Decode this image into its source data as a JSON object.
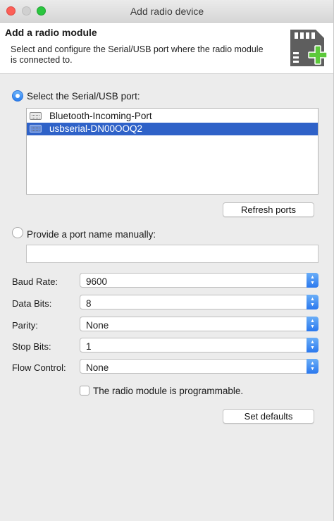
{
  "window": {
    "title": "Add radio device"
  },
  "header": {
    "title": "Add a radio module",
    "description": "Select and configure the Serial/USB port where the radio module is connected to.",
    "icon": "sd-card-add-icon"
  },
  "port_selection": {
    "serial_option_label": "Select the Serial/USB port:",
    "serial_option_checked": true,
    "ports": [
      {
        "label": "Bluetooth-Incoming-Port",
        "selected": false
      },
      {
        "label": "usbserial-DN00OOQ2",
        "selected": true
      }
    ],
    "refresh_button": "Refresh ports",
    "manual_option_label": "Provide a port name manually:",
    "manual_option_checked": false,
    "manual_port_value": ""
  },
  "settings": {
    "baud_rate": {
      "label": "Baud Rate:",
      "value": "9600"
    },
    "data_bits": {
      "label": "Data Bits:",
      "value": "8"
    },
    "parity": {
      "label": "Parity:",
      "value": "None"
    },
    "stop_bits": {
      "label": "Stop Bits:",
      "value": "1"
    },
    "flow_control": {
      "label": "Flow Control:",
      "value": "None"
    }
  },
  "programmable": {
    "label": "The radio module is programmable.",
    "checked": false
  },
  "set_defaults_button": "Set defaults",
  "colors": {
    "accent": "#2f62c8",
    "header_icon_bg": "#5e5e5e",
    "plus_green": "#5cc93a"
  }
}
